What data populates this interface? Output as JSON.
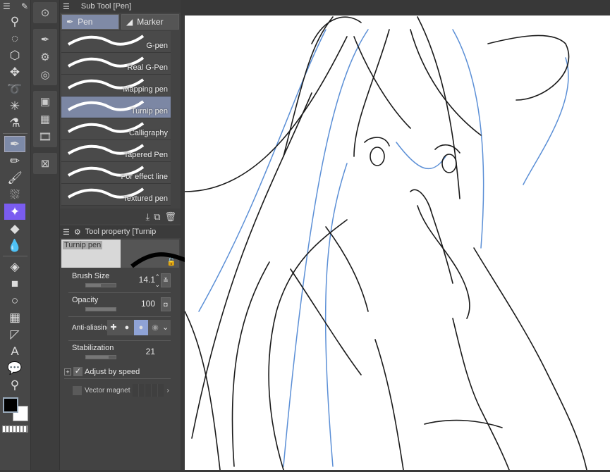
{
  "toolbar": {
    "tools": [
      "menu",
      "pen-tool",
      "zoom",
      "rotate",
      "object-select",
      "move",
      "lasso",
      "magic-wand",
      "eyedropper",
      "pen",
      "pencil",
      "brush",
      "airbrush",
      "ai-sparkle",
      "eraser",
      "blend",
      "fill",
      "gradient",
      "figure",
      "frame",
      "ruler",
      "text",
      "balloon",
      "correct-line"
    ],
    "active": "pen",
    "main_color": "#000000",
    "sub_color": "#ffffff"
  },
  "subtool": {
    "title": "Sub Tool [Pen]",
    "tabs": [
      {
        "label": "Pen",
        "selected": true
      },
      {
        "label": "Marker",
        "selected": false
      }
    ],
    "brushes": [
      {
        "label": "G-pen"
      },
      {
        "label": "Real G-Pen"
      },
      {
        "label": "Mapping pen"
      },
      {
        "label": "Turnip pen",
        "selected": true
      },
      {
        "label": "Calligraphy"
      },
      {
        "label": "Tapered Pen"
      },
      {
        "label": "For effect line"
      },
      {
        "label": "Textured pen"
      }
    ]
  },
  "property": {
    "title": "Tool property [Turnip",
    "preview_label": "Turnip pen",
    "brush_size": {
      "label": "Brush Size",
      "value": "14.1",
      "fill": 0.5
    },
    "opacity": {
      "label": "Opacity",
      "value": "100",
      "fill": 1.0
    },
    "anti_aliasing": {
      "label": "Anti-aliasing",
      "selected_index": 2
    },
    "stabilization": {
      "label": "Stabilization",
      "value": "21",
      "fill": 0.75
    },
    "adjust_by_speed": {
      "label": "Adjust by speed",
      "checked": true
    },
    "vector_magnet": {
      "label": "Vector magnet",
      "checked": false
    }
  },
  "colors": {
    "accent": "#7f8aa6",
    "line": "#1a1a1a",
    "sketch": "#5b8fd6"
  }
}
